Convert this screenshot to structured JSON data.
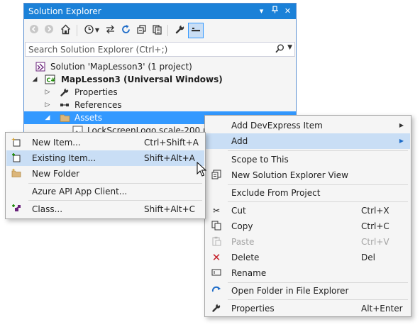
{
  "solution_explorer": {
    "title": "Solution Explorer",
    "title_buttons": [
      "▾",
      "🗗",
      "✕"
    ],
    "search_placeholder": "Search Solution Explorer (Ctrl+;)",
    "tree": [
      {
        "label": "Solution 'MapLesson3' (1 project)",
        "icon": "solution-icon",
        "bold": false
      },
      {
        "label": "MapLesson3 (Universal Windows)",
        "icon": "csharp-project-icon",
        "bold": true
      },
      {
        "label": "Properties",
        "icon": "wrench-icon",
        "bold": false
      },
      {
        "label": "References",
        "icon": "references-icon",
        "bold": false
      },
      {
        "label": "Assets",
        "icon": "folder-icon",
        "bold": false,
        "selected": true
      },
      {
        "label": "LockScreenLogo.scale-200.png",
        "icon": "image-file-icon",
        "bold": false
      }
    ]
  },
  "main_menu": {
    "items": [
      {
        "label": "Add DevExpress Item",
        "shortcut": "",
        "icon": "",
        "submenu": true
      },
      {
        "label": "Add",
        "shortcut": "",
        "icon": "",
        "submenu": true,
        "highlighted": true
      },
      {
        "label": "Scope to This",
        "shortcut": "",
        "icon": ""
      },
      {
        "label": "New Solution Explorer View",
        "shortcut": "",
        "icon": "new-view-icon"
      },
      {
        "label": "Exclude From Project",
        "shortcut": "",
        "icon": ""
      },
      {
        "label": "Cut",
        "shortcut": "Ctrl+X",
        "icon": "scissors-icon"
      },
      {
        "label": "Copy",
        "shortcut": "Ctrl+C",
        "icon": "copy-icon"
      },
      {
        "label": "Paste",
        "shortcut": "Ctrl+V",
        "icon": "paste-icon",
        "disabled": true
      },
      {
        "label": "Delete",
        "shortcut": "Del",
        "icon": "delete-icon"
      },
      {
        "label": "Rename",
        "shortcut": "",
        "icon": "rename-icon"
      },
      {
        "label": "Open Folder in File Explorer",
        "shortcut": "",
        "icon": "open-folder-icon"
      },
      {
        "label": "Properties",
        "shortcut": "Alt+Enter",
        "icon": "wrench-icon"
      }
    ]
  },
  "add_menu": {
    "items": [
      {
        "label": "New Item...",
        "shortcut": "Ctrl+Shift+A",
        "icon": "new-item-icon"
      },
      {
        "label": "Existing Item...",
        "shortcut": "Shift+Alt+A",
        "icon": "existing-item-icon",
        "highlighted": true
      },
      {
        "label": "New Folder",
        "shortcut": "",
        "icon": "new-folder-icon"
      },
      {
        "label": "Azure API App Client...",
        "shortcut": "",
        "icon": ""
      },
      {
        "label": "Class...",
        "shortcut": "Shift+Alt+C",
        "icon": "class-icon"
      }
    ]
  },
  "colors": {
    "title_bar": "#1b81d8",
    "selection": "#3399ff",
    "menu_highlight": "#c9def5",
    "delete_red": "#c5202a"
  }
}
